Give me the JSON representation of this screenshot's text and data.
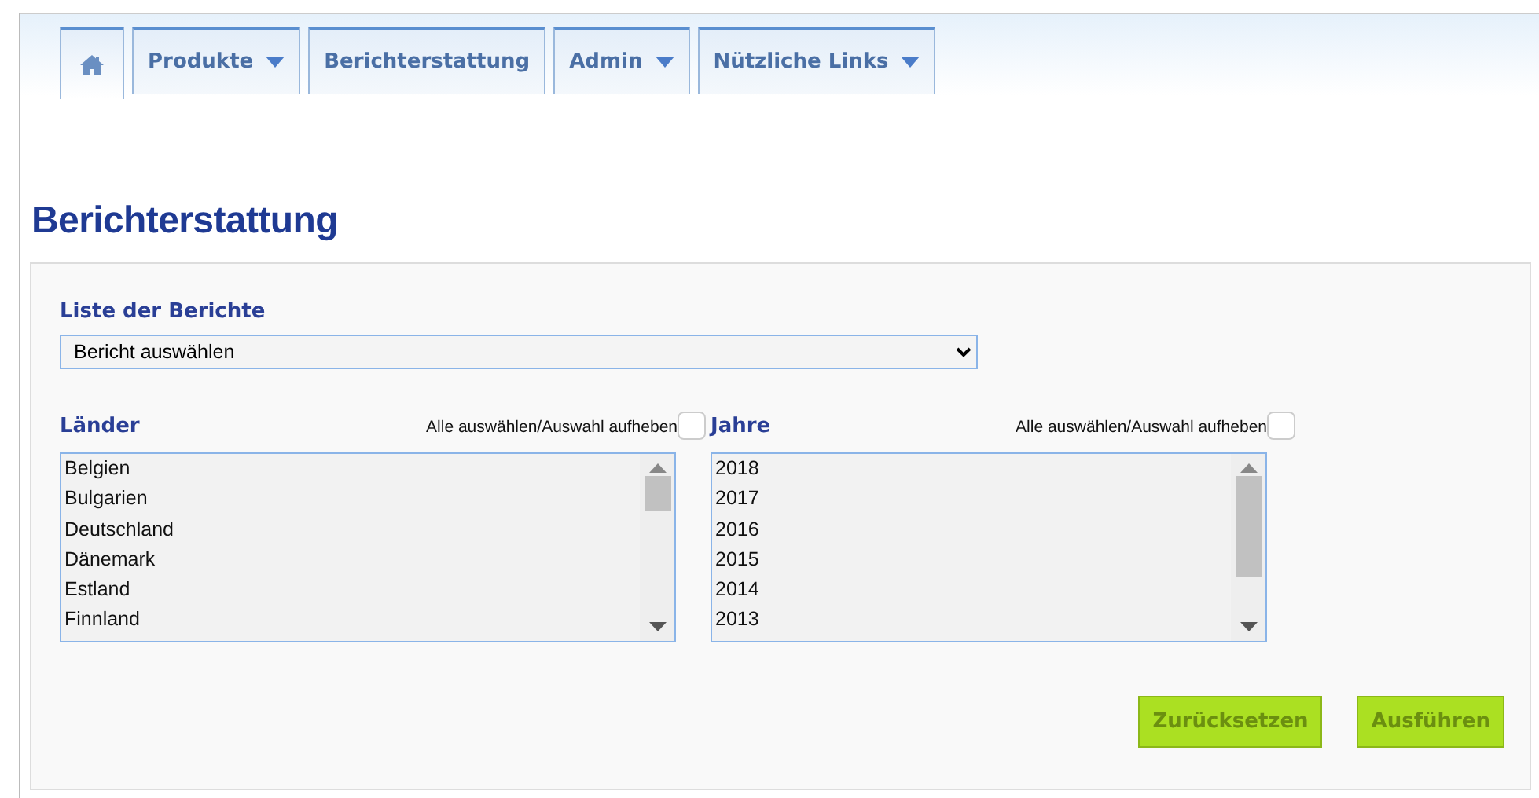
{
  "tabs": [
    {
      "kind": "home",
      "selected": true,
      "dropdown": false
    },
    {
      "label": "Produkte",
      "selected": false,
      "dropdown": true
    },
    {
      "label": "Berichterstattung",
      "selected": false,
      "dropdown": false
    },
    {
      "label": "Admin",
      "selected": false,
      "dropdown": true
    },
    {
      "label": "Nützliche Links",
      "selected": false,
      "dropdown": true
    }
  ],
  "page_title": "Berichterstattung",
  "report_list": {
    "label": "Liste der Berichte",
    "value": "Bericht auswählen"
  },
  "lists": [
    {
      "label": "Länder",
      "select_all_label": "Alle auswählen/Auswahl aufheben",
      "checked": false,
      "items": [
        "Belgien",
        "Bulgarien",
        "Deutschland",
        "Dänemark",
        "Estland",
        "Finnland"
      ]
    },
    {
      "label": "Jahre",
      "select_all_label": "Alle auswählen/Auswahl aufheben",
      "checked": false,
      "items": [
        "2018",
        "2017",
        "2016",
        "2015",
        "2014",
        "2013"
      ]
    }
  ],
  "buttons": [
    "Zurücksetzen",
    "Ausführen"
  ]
}
